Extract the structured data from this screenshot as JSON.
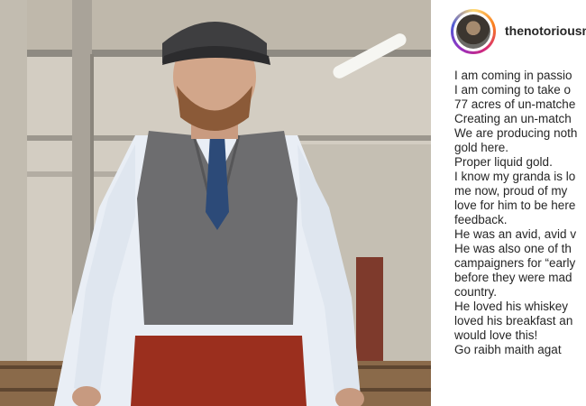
{
  "post": {
    "username": "thenotoriousm",
    "caption_lines": [
      "I am coming in passio",
      "I am coming to take o",
      "77 acres of un-matche",
      "Creating an un-match",
      "We are producing noth",
      "gold here.",
      "Proper liquid gold.",
      "I know my granda is lo",
      "me now, proud of my",
      "love for him to be here",
      "feedback.",
      "He was an avid, avid v",
      "He was also one of th",
      "campaigners for “early",
      "before they were mad",
      "country.",
      "He loved his whiskey",
      "loved his breakfast an",
      "would love this!",
      "Go raibh maith agat"
    ]
  },
  "colors": {
    "text": "#262626",
    "ring": [
      "#feda75",
      "#fa7e1e",
      "#d62976",
      "#962fbf",
      "#4f5bd5"
    ]
  }
}
